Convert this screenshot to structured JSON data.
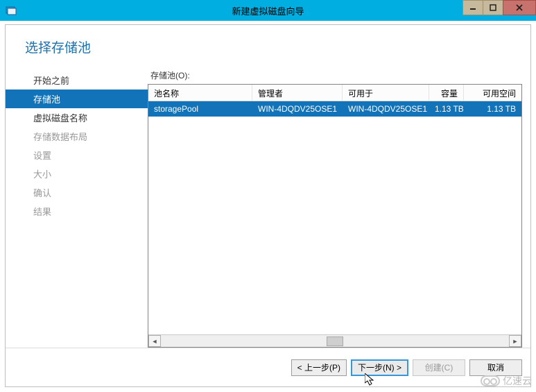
{
  "window": {
    "title": "新建虚拟磁盘向导"
  },
  "page": {
    "title": "选择存储池"
  },
  "sidebar": {
    "items": [
      {
        "label": "开始之前",
        "state": "done"
      },
      {
        "label": "存储池",
        "state": "active"
      },
      {
        "label": "虚拟磁盘名称",
        "state": "done"
      },
      {
        "label": "存储数据布局",
        "state": "disabled"
      },
      {
        "label": "设置",
        "state": "disabled"
      },
      {
        "label": "大小",
        "state": "disabled"
      },
      {
        "label": "确认",
        "state": "disabled"
      },
      {
        "label": "结果",
        "state": "disabled"
      }
    ]
  },
  "pane": {
    "label": "存储池(O):",
    "columns": {
      "name": "池名称",
      "manager": "管理者",
      "available_to": "可用于",
      "capacity": "容量",
      "free": "可用空间"
    },
    "rows": [
      {
        "name": "storagePool",
        "manager": "WIN-4DQDV25OSE1",
        "available_to": "WIN-4DQDV25OSE1",
        "capacity": "1.13 TB",
        "free": "1.13 TB"
      }
    ]
  },
  "footer": {
    "prev": "< 上一步(P)",
    "next": "下一步(N) >",
    "create": "创建(C)",
    "cancel": "取消"
  },
  "watermark": {
    "text": "亿速云"
  }
}
